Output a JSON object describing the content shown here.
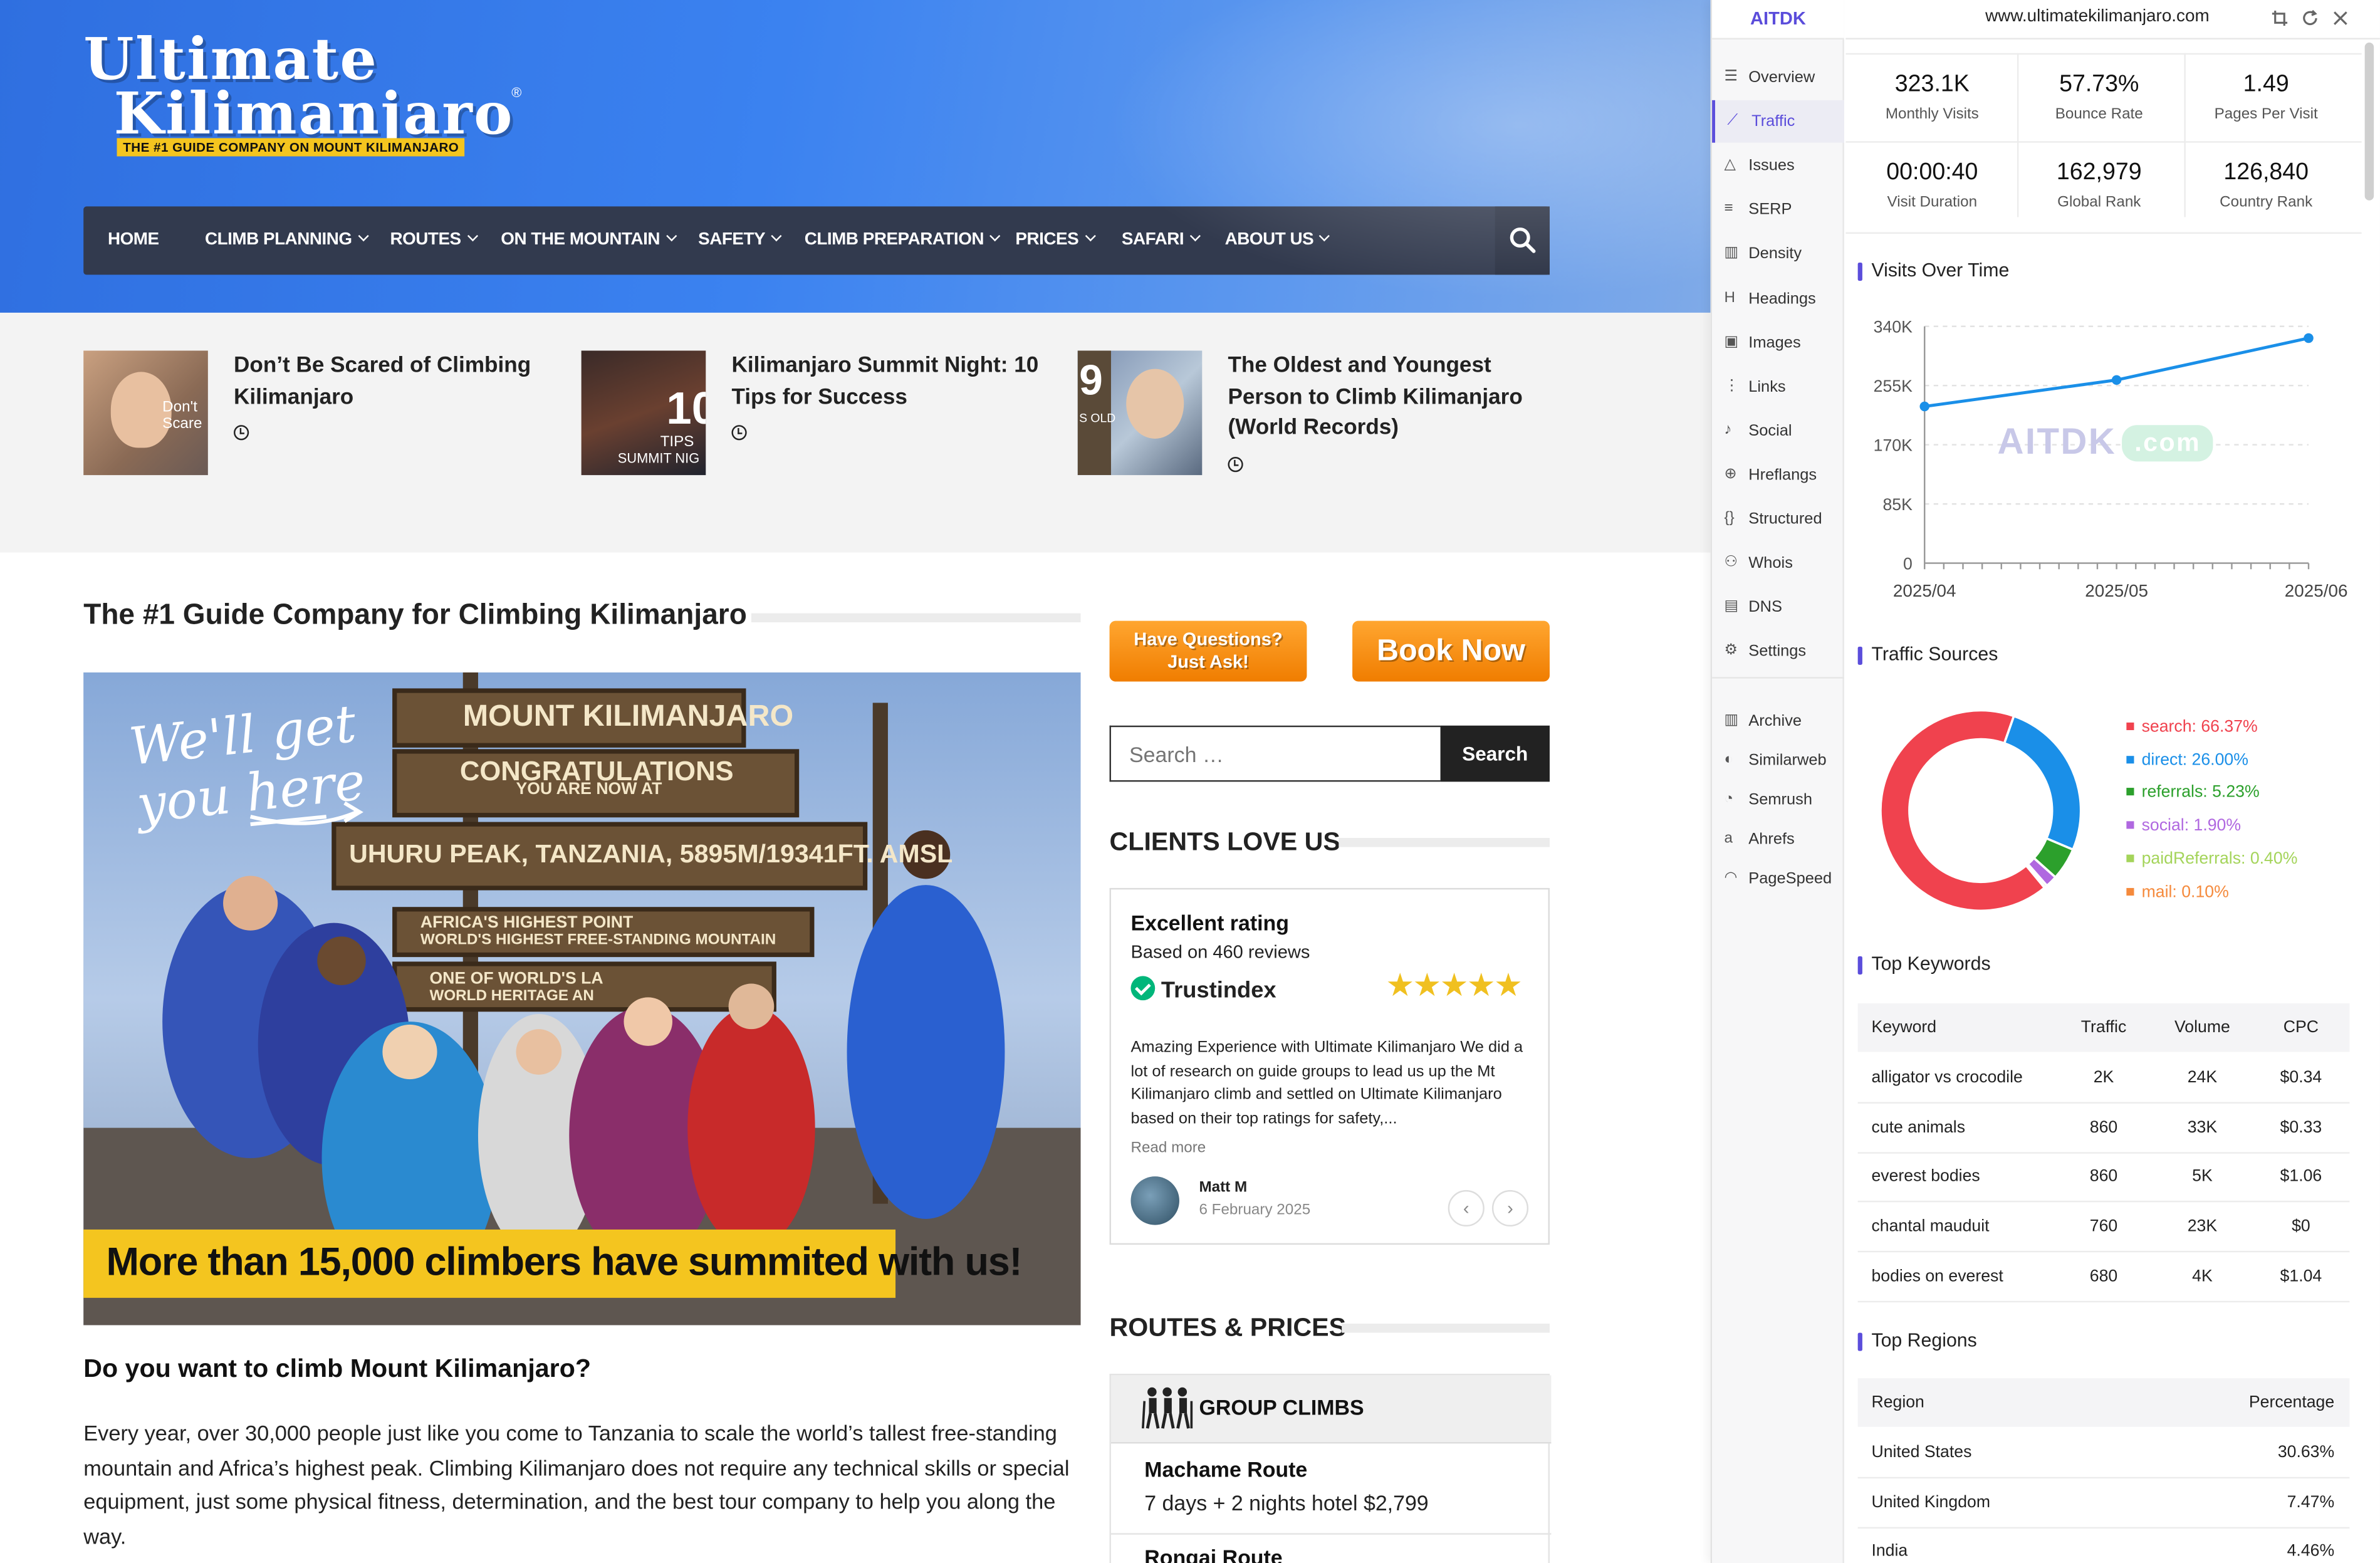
{
  "site": {
    "logo": {
      "line1": "Ultimate",
      "line2": "Kilimanjaro",
      "reg": "®",
      "tagline": "THE #1 GUIDE COMPANY ON MOUNT KILIMANJARO"
    },
    "nav": [
      {
        "label": "HOME",
        "has_dropdown": false
      },
      {
        "label": "CLIMB PLANNING",
        "has_dropdown": true
      },
      {
        "label": "ROUTES",
        "has_dropdown": true
      },
      {
        "label": "ON THE MOUNTAIN",
        "has_dropdown": true
      },
      {
        "label": "SAFETY",
        "has_dropdown": true
      },
      {
        "label": "CLIMB PREPARATION",
        "has_dropdown": true
      },
      {
        "label": "PRICES",
        "has_dropdown": true
      },
      {
        "label": "SAFARI",
        "has_dropdown": true
      },
      {
        "label": "ABOUT US",
        "has_dropdown": true
      }
    ],
    "posts": [
      {
        "title": "Don’t Be Scared of Climbing Kilimanjaro",
        "thumb_text": "Don't Scare"
      },
      {
        "title": "Kilimanjaro Summit Night: 10 Tips for Success",
        "thumb_text": "10",
        "thumb_text2": "TIPS",
        "thumb_text3": "SUMMIT NIG"
      },
      {
        "title": "The Oldest and Youngest Person to Climb Kilimanjaro (World Records)",
        "thumb_text": "9",
        "thumb_text2": "S OLD"
      }
    ],
    "main_heading": "The #1 Guide Company for Climbing Kilimanjaro",
    "hero_image": {
      "handwriting_1": "We'll get",
      "handwriting_2": "you here",
      "sign_1": "MOUNT KILIMANJARO",
      "sign_2": "CONGRATULATIONS",
      "sign_2b": "YOU ARE NOW AT",
      "sign_3": "UHURU PEAK, TANZANIA, 5895M/19341FT. AMSL",
      "sign_4": "AFRICA'S HIGHEST POINT",
      "sign_4b": "WORLD'S HIGHEST FREE-STANDING MOUNTAIN",
      "sign_5": "ONE OF WORLD'S LA",
      "sign_5b": "WORLD HERITAGE AN",
      "banner": "More than 15,000 climbers have summited with us!"
    },
    "question_heading": "Do you want to climb Mount Kilimanjaro?",
    "body_paragraph": "Every year, over 30,000 people just like you come to Tanzania to scale the world’s tallest free-standing mountain and Africa’s highest peak. Climbing Kilimanjaro does not require any technical skills or special equipment, just some physical fitness, determination, and the best tour company to help you along the way.",
    "btn_ask_line1": "Have Questions?",
    "btn_ask_line2": "Just Ask!",
    "btn_book": "Book Now",
    "search": {
      "placeholder": "Search …",
      "button": "Search"
    },
    "clients_heading": "CLIENTS LOVE US",
    "trustpilot": {
      "title": "Excellent rating",
      "based_on": "Based on 460 reviews",
      "brand": "Trustindex",
      "stars": "★★★★★",
      "review": "Amazing Experience with Ultimate Kilimanjaro We did a lot of research on guide groups to lead us up the Mt Kilimanjaro climb and settled on Ultimate Kilimanjaro based on their top ratings for safety,...",
      "read_more": "Read more",
      "author": "Matt M",
      "date": "6 February 2025",
      "prev": "‹",
      "next": "›"
    },
    "routes_heading": "ROUTES & PRICES",
    "routes": {
      "group_label": "GROUP CLIMBS",
      "items": [
        {
          "name": "Machame Route",
          "desc": "7 days + 2 nights hotel $2,799"
        },
        {
          "name": "Rongai Route",
          "desc": ""
        }
      ]
    }
  },
  "panel": {
    "brand": "AITDK",
    "url": "www.ultimatekilimanjaro.com",
    "nav": [
      {
        "label": "Overview",
        "icon": "overview-icon",
        "active": false
      },
      {
        "label": "Traffic",
        "icon": "traffic-icon",
        "active": true
      },
      {
        "label": "Issues",
        "icon": "issues-icon",
        "active": false
      },
      {
        "label": "SERP",
        "icon": "serp-icon",
        "active": false
      },
      {
        "label": "Density",
        "icon": "density-icon",
        "active": false
      },
      {
        "label": "Headings",
        "icon": "headings-icon",
        "active": false
      },
      {
        "label": "Images",
        "icon": "images-icon",
        "active": false
      },
      {
        "label": "Links",
        "icon": "links-icon",
        "active": false
      },
      {
        "label": "Social",
        "icon": "social-icon",
        "active": false
      },
      {
        "label": "Hreflangs",
        "icon": "hreflangs-icon",
        "active": false
      },
      {
        "label": "Structured",
        "icon": "structured-icon",
        "active": false
      },
      {
        "label": "Whois",
        "icon": "whois-icon",
        "active": false
      },
      {
        "label": "DNS",
        "icon": "dns-icon",
        "active": false
      },
      {
        "label": "Settings",
        "icon": "settings-icon",
        "active": false
      }
    ],
    "tools": [
      {
        "label": "Archive",
        "icon": "archive-icon"
      },
      {
        "label": "Similarweb",
        "icon": "similarweb-icon"
      },
      {
        "label": "Semrush",
        "icon": "semrush-icon"
      },
      {
        "label": "Ahrefs",
        "icon": "ahrefs-icon"
      },
      {
        "label": "PageSpeed",
        "icon": "pagespeed-icon"
      }
    ],
    "stats": [
      {
        "value": "323.1K",
        "label": "Monthly Visits"
      },
      {
        "value": "57.73%",
        "label": "Bounce Rate"
      },
      {
        "value": "1.49",
        "label": "Pages Per Visit"
      },
      {
        "value": "00:00:40",
        "label": "Visit Duration"
      },
      {
        "value": "162,979",
        "label": "Global Rank"
      },
      {
        "value": "126,840",
        "label": "Country Rank"
      }
    ],
    "visits_heading": "Visits Over Time",
    "sources_heading": "Traffic Sources",
    "keywords_heading": "Top Keywords",
    "regions_heading": "Top Regions",
    "watermark": "AITDK",
    "watermark_suffix": ".com",
    "keywords": {
      "columns": [
        "Keyword",
        "Traffic",
        "Volume",
        "CPC"
      ],
      "rows": [
        [
          "alligator vs crocodile",
          "2K",
          "24K",
          "$0.34"
        ],
        [
          "cute animals",
          "860",
          "33K",
          "$0.33"
        ],
        [
          "everest bodies",
          "860",
          "5K",
          "$1.06"
        ],
        [
          "chantal mauduit",
          "760",
          "23K",
          "$0"
        ],
        [
          "bodies on everest",
          "680",
          "4K",
          "$1.04"
        ]
      ]
    },
    "regions": {
      "columns": [
        "Region",
        "Percentage"
      ],
      "rows": [
        [
          "United States",
          "30.63%"
        ],
        [
          "United Kingdom",
          "7.47%"
        ],
        [
          "India",
          "4.46%"
        ]
      ]
    },
    "colors": {
      "accent": "#5b4ddb",
      "line": "#1a8fe8"
    }
  },
  "chart_data": [
    {
      "type": "line",
      "x": [
        "2025/04",
        "2025/05",
        "2025/06"
      ],
      "series": [
        {
          "values": [
            225000,
            263000,
            323100
          ]
        }
      ],
      "ylim": [
        0,
        340000
      ],
      "yticks": [
        0,
        85000,
        170000,
        255000,
        340000
      ],
      "ytick_labels": [
        "0",
        "85K",
        "170K",
        "255K",
        "340K"
      ],
      "grid": true
    },
    {
      "type": "pie",
      "labels": [
        "search",
        "direct",
        "referrals",
        "social",
        "paidReferrals",
        "mail"
      ],
      "values": [
        66.37,
        26.0,
        5.23,
        1.9,
        0.4,
        0.1
      ],
      "display": [
        "search: 66.37%",
        "direct: 26.00%",
        "referrals: 5.23%",
        "social: 1.90%",
        "paidReferrals: 0.40%",
        "mail: 0.10%"
      ],
      "colors": [
        "#f0424e",
        "#1a8fe8",
        "#2ca02c",
        "#b068e0",
        "#a4d45a",
        "#f58a3c"
      ],
      "legend": "right"
    }
  ]
}
